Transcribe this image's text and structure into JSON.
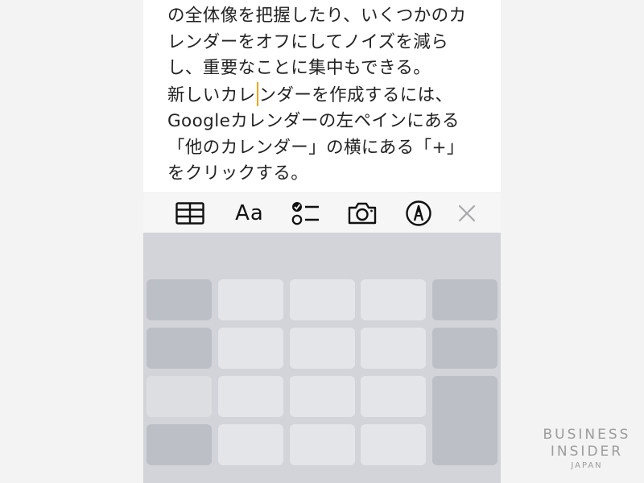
{
  "note": {
    "lines": [
      "の全体像を把握したり、いくつかのカ",
      "レンダーをオフにしてノイズを減ら",
      "し、重要なことに集中もできる。",
      "新しいカレ",
      "ンダーを作成するには、",
      "Googleカレンダーの左ペインにある",
      "「他のカレンダー」の横にある「+」",
      "をクリックする。"
    ]
  },
  "toolbar": {
    "table_icon": "table-icon",
    "format_label": "Aa",
    "checklist_icon": "checklist-icon",
    "camera_icon": "camera-icon",
    "markup_icon": "markup-pen-icon",
    "close_icon": "close-icon",
    "icon_color": "#111111",
    "close_color": "#a9a9ad"
  },
  "keyboard": {
    "background": "#d2d4d9",
    "light_key": "#e4e5e9",
    "dark_key": "#bcbfc6"
  },
  "watermark": {
    "line1": "BUSINESS",
    "line2": "INSIDER",
    "line3": "JAPAN"
  },
  "colors": {
    "caret": "#e8a800",
    "text": "#222222"
  }
}
